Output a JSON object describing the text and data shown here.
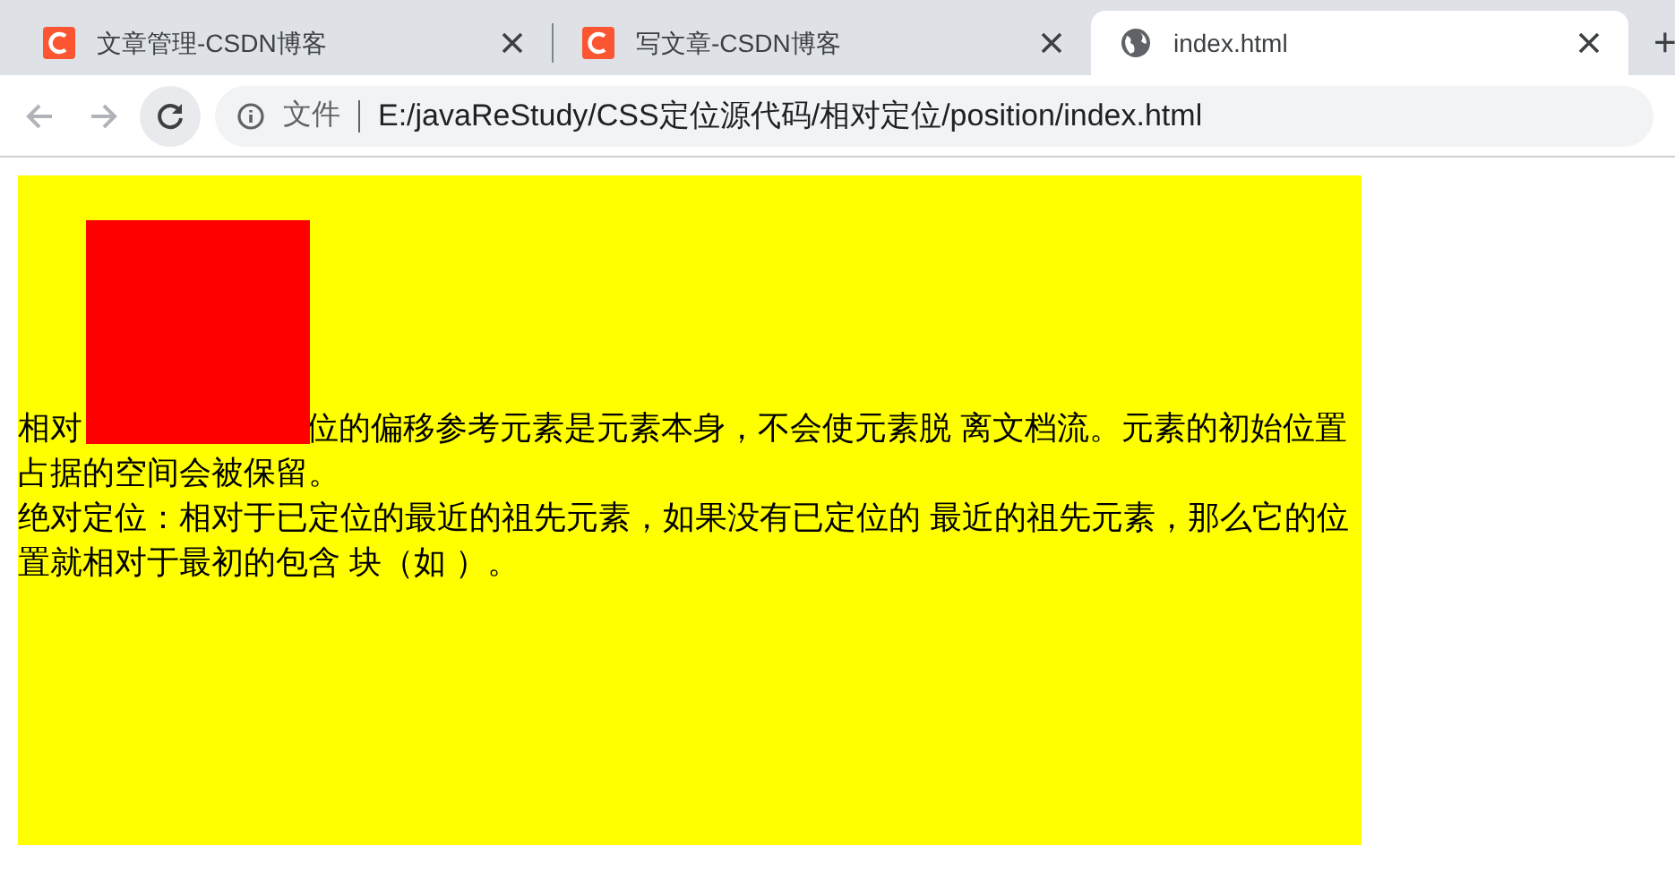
{
  "tabs": [
    {
      "title": "文章管理-CSDN博客",
      "kind": "csdn",
      "selected": false
    },
    {
      "title": "写文章-CSDN博客",
      "kind": "csdn",
      "selected": false
    },
    {
      "title": "index.html",
      "kind": "globe",
      "selected": true
    }
  ],
  "new_tab": "+",
  "address_bar": {
    "scheme_label": "文件",
    "url": "E:/javaReStudy/CSS定位源代码/相对定位/position/index.html"
  },
  "page": {
    "paragraphs": [
      {
        "before_covered": "相对",
        "after_covered": "位的偏移参考元素是元素本身，不会使元素脱 离文档流。元素的初始位置占据的空间会被保留。"
      },
      {
        "text": "绝对定位：相对于已定位的最近的祖先元素，如果没有已定位的 最近的祖先元素，那么它的位置就相对于最初的包含 块（如 ）。"
      }
    ]
  }
}
